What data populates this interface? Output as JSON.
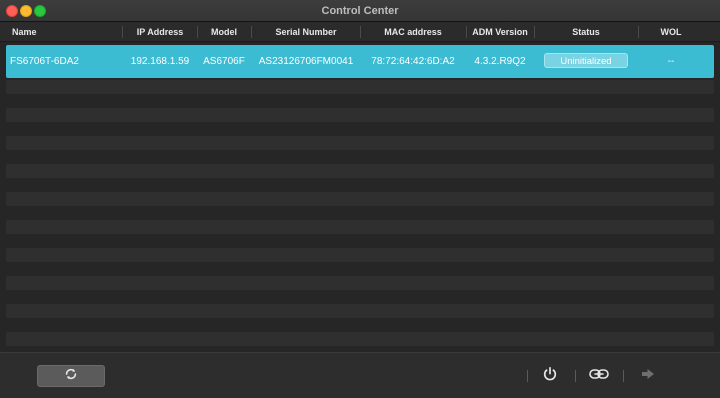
{
  "window": {
    "title": "Control Center"
  },
  "table": {
    "columns": [
      "Name",
      "IP Address",
      "Model",
      "Serial Number",
      "MAC address",
      "ADM Version",
      "Status",
      "WOL"
    ],
    "rows": [
      {
        "name": "FS6706T-6DA2",
        "ip": "192.168.1.59",
        "model": "AS6706F",
        "serial": "AS23126706FM0041",
        "mac": "78:72:64:42:6D:A2",
        "adm_version": "4.3.2.R9Q2",
        "status": "Uninitialized",
        "wol": "--"
      }
    ]
  },
  "footer": {
    "refresh_icon": "refresh-icon",
    "power_icon": "power-icon",
    "link_icon": "link-icon",
    "arrow_icon": "arrow-right-icon"
  },
  "colors": {
    "selection": "#3bbcd3",
    "status_badge": "#7ad3e3"
  }
}
